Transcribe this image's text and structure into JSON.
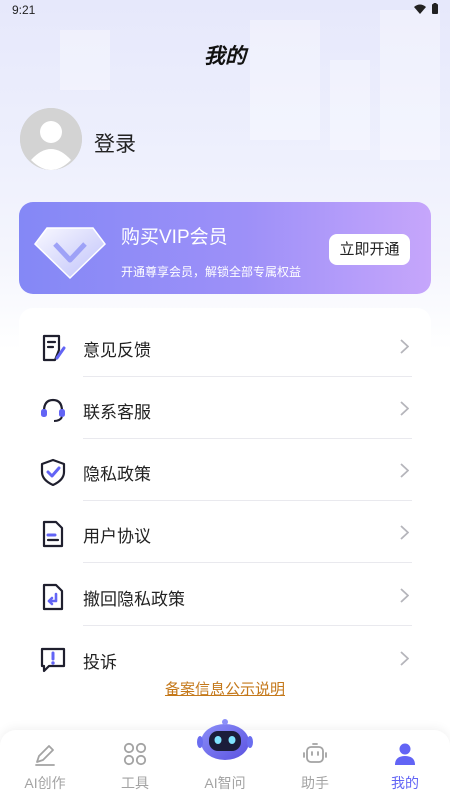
{
  "status_bar": {
    "time": "9:21"
  },
  "header": {
    "title": "我的"
  },
  "profile": {
    "login_label": "登录"
  },
  "vip": {
    "title": "购买VIP会员",
    "subtitle": "开通尊享会员，解锁全部专属权益",
    "button_label": "立即开通"
  },
  "menu": {
    "items": [
      {
        "label": "意见反馈",
        "icon": "feedback-icon"
      },
      {
        "label": "联系客服",
        "icon": "headset-icon"
      },
      {
        "label": "隐私政策",
        "icon": "shield-check-icon"
      },
      {
        "label": "用户协议",
        "icon": "document-icon"
      },
      {
        "label": "撤回隐私政策",
        "icon": "document-return-icon"
      },
      {
        "label": "投诉",
        "icon": "complaint-icon"
      }
    ]
  },
  "footer": {
    "beian_link": "备案信息公示说明"
  },
  "tabbar": {
    "items": [
      {
        "label": "AI创作",
        "icon": "pen-icon"
      },
      {
        "label": "工具",
        "icon": "grid-icon"
      },
      {
        "label": "AI智问",
        "icon": "robot-icon"
      },
      {
        "label": "助手",
        "icon": "assistant-icon"
      },
      {
        "label": "我的",
        "icon": "person-icon"
      }
    ],
    "active_index": 4
  },
  "colors": {
    "accent": "#6264f5",
    "vip_gradient_start": "#8488f6",
    "vip_gradient_end": "#c6a6fb",
    "link": "#c4781a"
  }
}
